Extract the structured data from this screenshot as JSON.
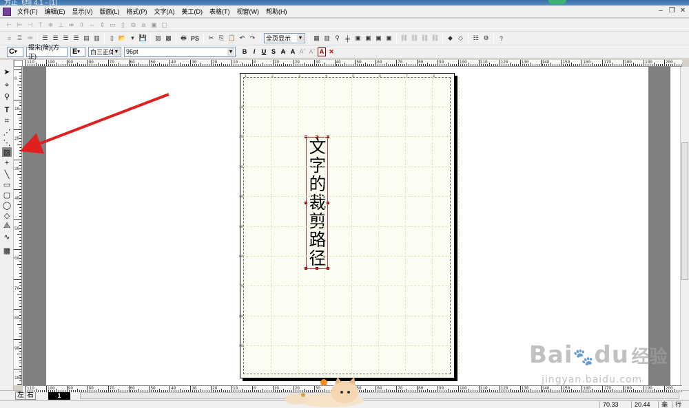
{
  "titlebar": {
    "title": "方正飞翔 4.1 - [1]"
  },
  "menu": [
    "文件(F)",
    "编辑(E)",
    "显示(V)",
    "版面(L)",
    "格式(P)",
    "文字(A)",
    "美工(D)",
    "表格(T)",
    "视窗(W)",
    "帮助(H)"
  ],
  "toolbar2": {
    "print_label": "PS",
    "zoom_select": "全页显示"
  },
  "format_bar": {
    "font_style": "C",
    "chinese_font": "报宋(简)(方正)",
    "western_font": "E",
    "western_font_name": "白三正体",
    "font_size": "96pt",
    "bold": "B",
    "italic": "I",
    "underline": "U",
    "shadow": "S",
    "strike": "A",
    "superscript": "A",
    "clear": "A",
    "delete": "✕"
  },
  "ruler_top_labels": [
    "110",
    "100",
    "90",
    "80",
    "70",
    "60",
    "50",
    "40",
    "30",
    "20",
    "10",
    "0",
    "10",
    "20",
    "30",
    "40",
    "50",
    "60",
    "70",
    "80",
    "90",
    "100",
    "110",
    "120",
    "130",
    "140",
    "150",
    "160",
    "170",
    "180",
    "190",
    "200"
  ],
  "ruler_left_labels": [
    "0",
    "10",
    "20",
    "30",
    "40",
    "50",
    "60",
    "70",
    "80",
    "90",
    "100"
  ],
  "page_column_numbers": [
    "1",
    "2",
    "3",
    "4",
    "5",
    "6",
    "7",
    "8"
  ],
  "page_row_numbers": [
    "10",
    "20",
    "30",
    "40",
    "50",
    "60",
    "70",
    "80",
    "90"
  ],
  "document": {
    "vertical_text": [
      "文",
      "字",
      "的",
      "裁",
      "剪",
      "路",
      "径"
    ]
  },
  "pagebar": {
    "left_label": "左",
    "right_label": "右",
    "current_page": "1"
  },
  "status": {
    "x": "70.33",
    "y": "20.44",
    "unit": "毫",
    "mode": "行"
  },
  "watermark": {
    "brand": "Bai",
    "brand2": "du",
    "cn": "经验",
    "url": "jingyan.baidu.com"
  },
  "colors": {
    "arrow": "#e02020",
    "selection": "#d02030",
    "page_grid": "#dfe6b8"
  }
}
